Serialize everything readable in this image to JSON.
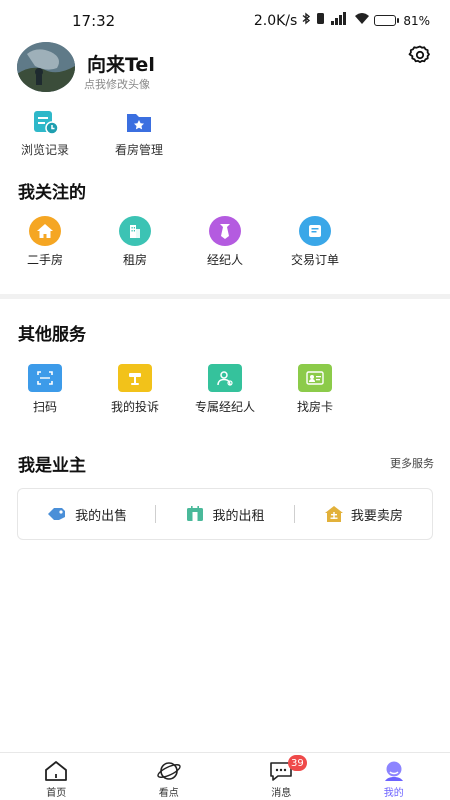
{
  "status_bar": {
    "time": "17:32",
    "net_speed": "2.0K/s",
    "battery_percent": "81%",
    "battery_level": 0.81
  },
  "profile": {
    "username": "向来Tel",
    "avatar_hint": "点我修改头像",
    "settings_icon": "gear-icon"
  },
  "quick_actions": [
    {
      "label": "浏览记录",
      "icon": "history-icon",
      "color": "#2fb8c9"
    },
    {
      "label": "看房管理",
      "icon": "folder-star-icon",
      "color": "#3b6fe0"
    }
  ],
  "following": {
    "title": "我关注的",
    "items": [
      {
        "label": "二手房",
        "icon": "home-icon",
        "color": "#f5a623"
      },
      {
        "label": "租房",
        "icon": "building-icon",
        "color": "#3cc3b4"
      },
      {
        "label": "经纪人",
        "icon": "tie-icon",
        "color": "#b45be0"
      },
      {
        "label": "交易订单",
        "icon": "order-icon",
        "color": "#3aa7e8"
      }
    ]
  },
  "other_services": {
    "title": "其他服务",
    "items": [
      {
        "label": "扫码",
        "icon": "scan-icon",
        "color": "#3d9be9"
      },
      {
        "label": "我的投诉",
        "icon": "complaint-icon",
        "color": "#f2c21a"
      },
      {
        "label": "专属经纪人",
        "icon": "agent-icon",
        "color": "#35c29c"
      },
      {
        "label": "找房卡",
        "icon": "card-icon",
        "color": "#8ccb4a"
      }
    ]
  },
  "owner": {
    "title": "我是业主",
    "more_label": "更多服务",
    "buttons": [
      {
        "label": "我的出售",
        "icon": "price-tag-icon",
        "color": "#4a8fd8"
      },
      {
        "label": "我的出租",
        "icon": "rent-icon",
        "color": "#4ab99a"
      },
      {
        "label": "我要卖房",
        "icon": "sell-house-icon",
        "color": "#e2b13a"
      }
    ]
  },
  "bottom_nav": {
    "items": [
      {
        "label": "首页",
        "icon": "home-outline-icon"
      },
      {
        "label": "看点",
        "icon": "planet-icon"
      },
      {
        "label": "消息",
        "icon": "message-icon",
        "badge": "39"
      },
      {
        "label": "我的",
        "icon": "user-icon",
        "active": true
      }
    ],
    "accent": "#6c63ff"
  }
}
